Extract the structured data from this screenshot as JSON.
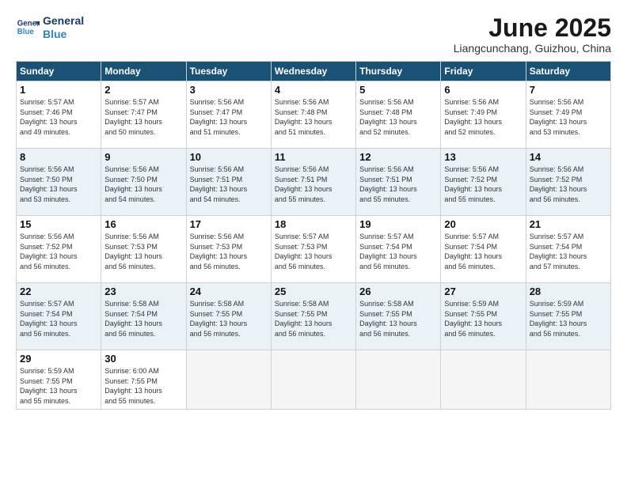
{
  "header": {
    "logo_line1": "General",
    "logo_line2": "Blue",
    "month": "June 2025",
    "location": "Liangcunchang, Guizhou, China"
  },
  "weekdays": [
    "Sunday",
    "Monday",
    "Tuesday",
    "Wednesday",
    "Thursday",
    "Friday",
    "Saturday"
  ],
  "weeks": [
    [
      {
        "day": "1",
        "info": "Sunrise: 5:57 AM\nSunset: 7:46 PM\nDaylight: 13 hours\nand 49 minutes."
      },
      {
        "day": "2",
        "info": "Sunrise: 5:57 AM\nSunset: 7:47 PM\nDaylight: 13 hours\nand 50 minutes."
      },
      {
        "day": "3",
        "info": "Sunrise: 5:56 AM\nSunset: 7:47 PM\nDaylight: 13 hours\nand 51 minutes."
      },
      {
        "day": "4",
        "info": "Sunrise: 5:56 AM\nSunset: 7:48 PM\nDaylight: 13 hours\nand 51 minutes."
      },
      {
        "day": "5",
        "info": "Sunrise: 5:56 AM\nSunset: 7:48 PM\nDaylight: 13 hours\nand 52 minutes."
      },
      {
        "day": "6",
        "info": "Sunrise: 5:56 AM\nSunset: 7:49 PM\nDaylight: 13 hours\nand 52 minutes."
      },
      {
        "day": "7",
        "info": "Sunrise: 5:56 AM\nSunset: 7:49 PM\nDaylight: 13 hours\nand 53 minutes."
      }
    ],
    [
      {
        "day": "8",
        "info": "Sunrise: 5:56 AM\nSunset: 7:50 PM\nDaylight: 13 hours\nand 53 minutes."
      },
      {
        "day": "9",
        "info": "Sunrise: 5:56 AM\nSunset: 7:50 PM\nDaylight: 13 hours\nand 54 minutes."
      },
      {
        "day": "10",
        "info": "Sunrise: 5:56 AM\nSunset: 7:51 PM\nDaylight: 13 hours\nand 54 minutes."
      },
      {
        "day": "11",
        "info": "Sunrise: 5:56 AM\nSunset: 7:51 PM\nDaylight: 13 hours\nand 55 minutes."
      },
      {
        "day": "12",
        "info": "Sunrise: 5:56 AM\nSunset: 7:51 PM\nDaylight: 13 hours\nand 55 minutes."
      },
      {
        "day": "13",
        "info": "Sunrise: 5:56 AM\nSunset: 7:52 PM\nDaylight: 13 hours\nand 55 minutes."
      },
      {
        "day": "14",
        "info": "Sunrise: 5:56 AM\nSunset: 7:52 PM\nDaylight: 13 hours\nand 56 minutes."
      }
    ],
    [
      {
        "day": "15",
        "info": "Sunrise: 5:56 AM\nSunset: 7:52 PM\nDaylight: 13 hours\nand 56 minutes."
      },
      {
        "day": "16",
        "info": "Sunrise: 5:56 AM\nSunset: 7:53 PM\nDaylight: 13 hours\nand 56 minutes."
      },
      {
        "day": "17",
        "info": "Sunrise: 5:56 AM\nSunset: 7:53 PM\nDaylight: 13 hours\nand 56 minutes."
      },
      {
        "day": "18",
        "info": "Sunrise: 5:57 AM\nSunset: 7:53 PM\nDaylight: 13 hours\nand 56 minutes."
      },
      {
        "day": "19",
        "info": "Sunrise: 5:57 AM\nSunset: 7:54 PM\nDaylight: 13 hours\nand 56 minutes."
      },
      {
        "day": "20",
        "info": "Sunrise: 5:57 AM\nSunset: 7:54 PM\nDaylight: 13 hours\nand 56 minutes."
      },
      {
        "day": "21",
        "info": "Sunrise: 5:57 AM\nSunset: 7:54 PM\nDaylight: 13 hours\nand 57 minutes."
      }
    ],
    [
      {
        "day": "22",
        "info": "Sunrise: 5:57 AM\nSunset: 7:54 PM\nDaylight: 13 hours\nand 56 minutes."
      },
      {
        "day": "23",
        "info": "Sunrise: 5:58 AM\nSunset: 7:54 PM\nDaylight: 13 hours\nand 56 minutes."
      },
      {
        "day": "24",
        "info": "Sunrise: 5:58 AM\nSunset: 7:55 PM\nDaylight: 13 hours\nand 56 minutes."
      },
      {
        "day": "25",
        "info": "Sunrise: 5:58 AM\nSunset: 7:55 PM\nDaylight: 13 hours\nand 56 minutes."
      },
      {
        "day": "26",
        "info": "Sunrise: 5:58 AM\nSunset: 7:55 PM\nDaylight: 13 hours\nand 56 minutes."
      },
      {
        "day": "27",
        "info": "Sunrise: 5:59 AM\nSunset: 7:55 PM\nDaylight: 13 hours\nand 56 minutes."
      },
      {
        "day": "28",
        "info": "Sunrise: 5:59 AM\nSunset: 7:55 PM\nDaylight: 13 hours\nand 56 minutes."
      }
    ],
    [
      {
        "day": "29",
        "info": "Sunrise: 5:59 AM\nSunset: 7:55 PM\nDaylight: 13 hours\nand 55 minutes."
      },
      {
        "day": "30",
        "info": "Sunrise: 6:00 AM\nSunset: 7:55 PM\nDaylight: 13 hours\nand 55 minutes."
      },
      {
        "day": "",
        "info": ""
      },
      {
        "day": "",
        "info": ""
      },
      {
        "day": "",
        "info": ""
      },
      {
        "day": "",
        "info": ""
      },
      {
        "day": "",
        "info": ""
      }
    ]
  ]
}
